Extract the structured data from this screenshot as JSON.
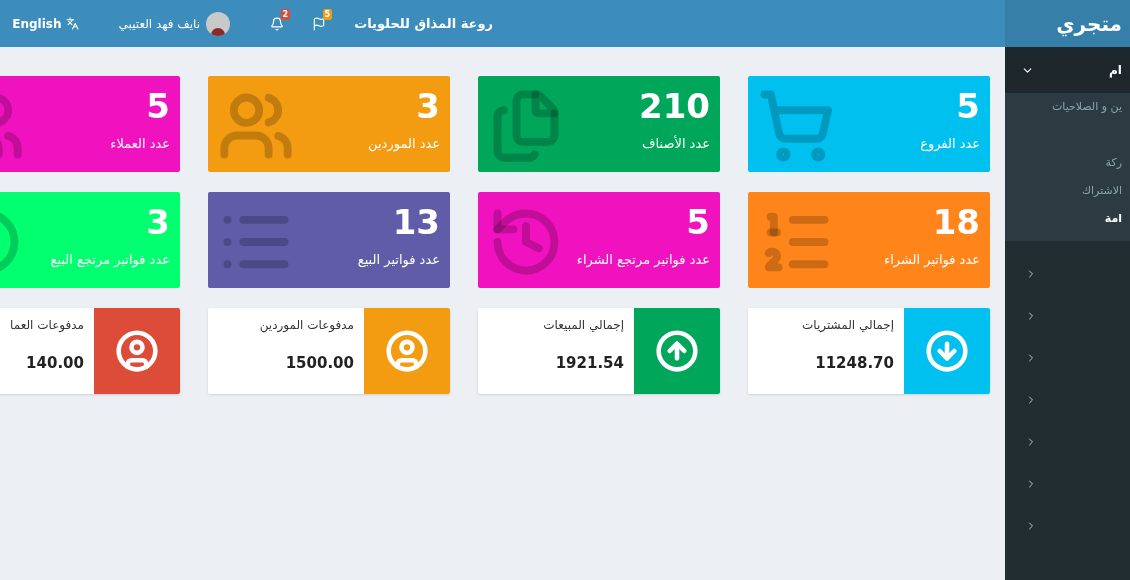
{
  "topbar": {
    "store_name": "روعة المذاق للحلويات",
    "notifications": [
      {
        "count": "5",
        "color": "#f39c12"
      },
      {
        "count": "2",
        "color": "#dd4b39"
      }
    ],
    "user_name": "نايف فهد العتيبي",
    "language": "English"
  },
  "sidebar": {
    "logo": "متجري",
    "active_item": {
      "label": "ام",
      "expanded": true
    },
    "subitems": [
      {
        "label": "ين و الصلاحيات",
        "selected": false
      },
      {
        "label": "ركة",
        "selected": false
      },
      {
        "label": "الاشتراك",
        "selected": false
      },
      {
        "label": "امة",
        "selected": true
      }
    ],
    "collapsed_items": [
      {
        "expanded": false
      },
      {
        "expanded": false
      },
      {
        "expanded": false
      },
      {
        "expanded": false
      },
      {
        "expanded": false
      },
      {
        "expanded": false
      },
      {
        "expanded": false
      }
    ]
  },
  "tiles": [
    {
      "value": "5",
      "label": "عدد الفروع",
      "color": "#00c0ef"
    },
    {
      "value": "210",
      "label": "عدد الأصناف",
      "color": "#00a65a"
    },
    {
      "value": "3",
      "label": "عدد الموردين",
      "color": "#f39c12"
    },
    {
      "value": "5",
      "label": "عدد العملاء",
      "color": "#f012be"
    },
    {
      "value": "18",
      "label": "عدد فواتير الشراء",
      "color": "#ff851b"
    },
    {
      "value": "5",
      "label": "عدد فواتير مرتجع الشراء",
      "color": "#f012be"
    },
    {
      "value": "13",
      "label": "عدد فواتير البيع",
      "color": "#605ca8"
    },
    {
      "value": "3",
      "label": "عدد فواتير مرتجع البيع",
      "color": "#01ff70"
    }
  ],
  "info_boxes": [
    {
      "label": "إجمالي المشتريات",
      "value": "11248.70",
      "color": "#00c0ef"
    },
    {
      "label": "إجمالي المبيعات",
      "value": "1921.54",
      "color": "#00a65a"
    },
    {
      "label": "مدفوعات الموردين",
      "value": "1500.00",
      "color": "#f39c12"
    },
    {
      "label": "مدفوعات العما",
      "value": "140.00",
      "color": "#dd4b39"
    }
  ]
}
